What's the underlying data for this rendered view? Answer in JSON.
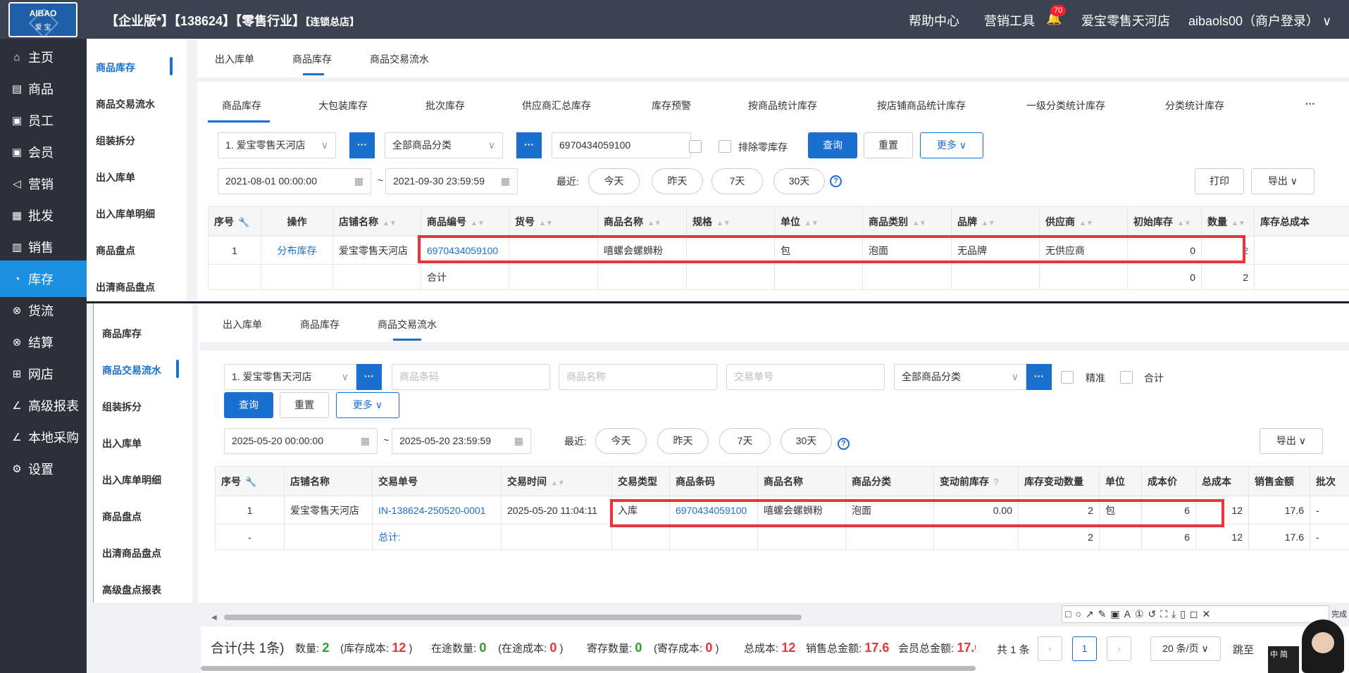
{
  "topbar": {
    "logo_top": "AIBAO",
    "logo_bottom": "爱 宝",
    "title_main": "【企业版*】【138624】【零售行业】",
    "title_small": "【连锁总店】",
    "help_center": "帮助中心",
    "marketing_tools": "营销工具",
    "notification_count": "70",
    "store_name": "爱宝零售天河店",
    "user": "aibaols00（商户登录）"
  },
  "sidebar": {
    "items": [
      {
        "icon": "home-icon",
        "glyph": "⌂",
        "label": "主页"
      },
      {
        "icon": "product-icon",
        "glyph": "▤",
        "label": "商品"
      },
      {
        "icon": "employee-icon",
        "glyph": "▣",
        "label": "员工"
      },
      {
        "icon": "member-icon",
        "glyph": "▣",
        "label": "会员"
      },
      {
        "icon": "marketing-icon",
        "glyph": "◁",
        "label": "营销"
      },
      {
        "icon": "wholesale-icon",
        "glyph": "▦",
        "label": "批发"
      },
      {
        "icon": "sales-icon",
        "glyph": "▥",
        "label": "销售"
      },
      {
        "icon": "inventory-icon",
        "glyph": "◔",
        "label": "库存"
      },
      {
        "icon": "logistics-icon",
        "glyph": "⊗",
        "label": "货流"
      },
      {
        "icon": "settlement-icon",
        "glyph": "⊗",
        "label": "结算"
      },
      {
        "icon": "webstore-icon",
        "glyph": "⊞",
        "label": "网店"
      },
      {
        "icon": "report-icon",
        "glyph": "∠",
        "label": "高级报表"
      },
      {
        "icon": "purchase-icon",
        "glyph": "∠",
        "label": "本地采购"
      },
      {
        "icon": "settings-icon",
        "glyph": "⚙",
        "label": "设置"
      }
    ]
  },
  "submenu_top": [
    "商品库存",
    "商品交易流水",
    "组装拆分",
    "出入库单",
    "出入库单明细",
    "商品盘点",
    "出清商品盘点"
  ],
  "submenu_bottom": [
    "商品库存",
    "商品交易流水",
    "组装拆分",
    "出入库单",
    "出入库单明细",
    "商品盘点",
    "出清商品盘点",
    "高级盘点报表"
  ],
  "top_panel": {
    "page_tabs": [
      "出入库单",
      "商品库存",
      "商品交易流水"
    ],
    "sub_tabs": [
      "商品库存",
      "大包装库存",
      "批次库存",
      "供应商汇总库存",
      "库存预警",
      "按商品统计库存",
      "按店铺商品统计库存",
      "一级分类统计库存",
      "分类统计库存"
    ],
    "more_tabs": "···",
    "store_select": "1. 爱宝零售天河店",
    "category_select": "全部商品分类",
    "barcode_input": "6970434059100",
    "exclude_zero": "排除零库存",
    "query": "查询",
    "reset": "重置",
    "more": "更多",
    "date_from": "2021-08-01 00:00:00",
    "date_to": "2021-09-30 23:59:59",
    "recent_label": "最近:",
    "today": "今天",
    "yesterday": "昨天",
    "days7": "7天",
    "days30": "30天",
    "print": "打印",
    "export": "导出",
    "columns": [
      "序号",
      "操作",
      "店铺名称",
      "商品编号",
      "货号",
      "商品名称",
      "规格",
      "单位",
      "商品类别",
      "品牌",
      "供应商",
      "初始库存",
      "数量",
      "库存总成本"
    ],
    "row": {
      "no": "1",
      "action": "分布库存",
      "store": "爱宝零售天河店",
      "code": "6970434059100",
      "item_no": "",
      "name": "嘻螺会螺蛳粉",
      "spec": "",
      "unit": "包",
      "category": "泡面",
      "brand": "无品牌",
      "supplier": "无供应商",
      "initial": "0",
      "qty": "2"
    },
    "total_label": "合计",
    "total_initial": "0",
    "total_qty": "2"
  },
  "bottom_panel": {
    "page_tabs": [
      "出入库单",
      "商品库存",
      "商品交易流水"
    ],
    "store_select": "1. 爱宝零售天河店",
    "barcode_placeholder": "商品条码",
    "name_placeholder": "商品名称",
    "order_placeholder": "交易单号",
    "category_select": "全部商品分类",
    "exact": "精准",
    "sum": "合计",
    "query": "查询",
    "reset": "重置",
    "more": "更多",
    "date_from": "2025-05-20 00:00:00",
    "date_to": "2025-05-20 23:59:59",
    "recent_label": "最近:",
    "today": "今天",
    "yesterday": "昨天",
    "days7": "7天",
    "days30": "30天",
    "export": "导出",
    "columns": [
      "序号",
      "店铺名称",
      "交易单号",
      "交易时间",
      "交易类型",
      "商品条码",
      "商品名称",
      "商品分类",
      "变动前库存",
      "库存变动数量",
      "单位",
      "成本价",
      "总成本",
      "销售金额",
      "批次"
    ],
    "row": {
      "no": "1",
      "store": "爱宝零售天河店",
      "order": "IN-138624-250520-0001",
      "time": "2025-05-20 11:04:11",
      "type": "入库",
      "barcode": "6970434059100",
      "name": "嘻螺会螺蛳粉",
      "category": "泡面",
      "before": "0.00",
      "change": "2",
      "unit": "包",
      "cost": "6",
      "total_cost": "12",
      "sales": "17.6",
      "batch": "-"
    },
    "total": {
      "no": "-",
      "label": "总计:",
      "change": "2",
      "cost": "6",
      "total_cost": "12",
      "sales": "17.6",
      "batch": "-"
    }
  },
  "footer": {
    "total": "合计(共 1条)",
    "qty_label": "数量:",
    "qty": "2",
    "stock_cost_label": "(库存成本:",
    "stock_cost": "12",
    "close_paren": ")",
    "transit_label": "在途数量:",
    "transit": "0",
    "transit_cost_label": "(在途成本:",
    "transit_cost": "0",
    "consign_label": "寄存数量:",
    "consign": "0",
    "consign_cost_label": "(寄存成本:",
    "consign_cost": "0",
    "total_cost_label": "总成本:",
    "total_cost": "12",
    "sales_total_label": "销售总金额:",
    "sales_total": "17.6",
    "member_total_label": "会员总金额:",
    "member_total": "17.6",
    "records": "共 1 条",
    "page": "1",
    "page_size": "20 条/页",
    "jump": "跳至"
  },
  "snip_toolbar": "□○↗✎▣A①↺⛶⤓▯◻✕",
  "snip_done": "完成",
  "ime": "中 简",
  "colors": {
    "accent": "#1a6fcf",
    "highlight": "#e8343a",
    "topbar": "#3c4350",
    "sidebar": "#2b303b",
    "active": "#1d8fe1"
  }
}
